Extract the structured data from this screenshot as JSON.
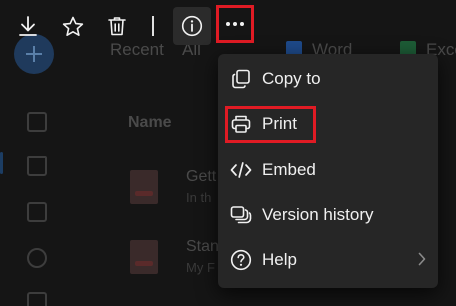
{
  "background": {
    "tabs": [
      {
        "label": "Recent"
      },
      {
        "label": "All"
      },
      {
        "label": "Word",
        "icon": "word-icon",
        "color": "#1e4a8a"
      },
      {
        "label": "Exce",
        "icon": "excel-icon",
        "color": "#1d5c36"
      }
    ],
    "column_name": "Name",
    "files": [
      {
        "title": "Gett",
        "subtitle": "In th"
      },
      {
        "title": "Stan",
        "subtitle": "My F"
      }
    ]
  },
  "toolbar": {
    "download": "download-icon",
    "favorite": "star-icon",
    "delete": "trash-icon",
    "info": "info-icon",
    "more": "more-icon"
  },
  "menu": {
    "items": [
      {
        "label": "Copy to",
        "icon": "copy-icon"
      },
      {
        "label": "Print",
        "icon": "print-icon"
      },
      {
        "label": "Embed",
        "icon": "embed-icon"
      },
      {
        "label": "Version history",
        "icon": "version-history-icon"
      },
      {
        "label": "Help",
        "icon": "help-icon",
        "submenu": true
      }
    ]
  },
  "colors": {
    "highlight": "#e01b24",
    "menu_bg": "#262626",
    "page_bg": "#151515"
  }
}
